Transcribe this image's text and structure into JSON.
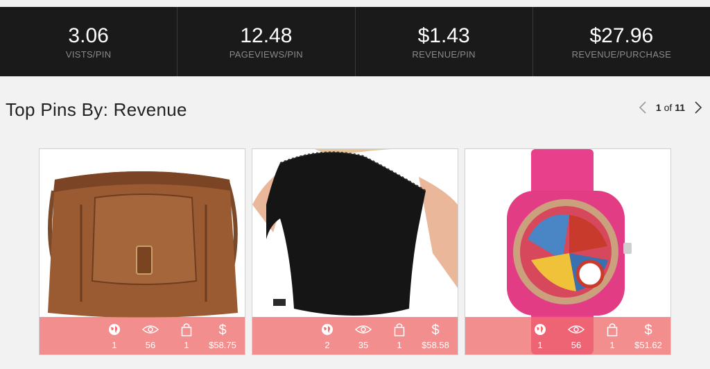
{
  "stats": [
    {
      "value": "3.06",
      "label": "VISTS/PIN"
    },
    {
      "value": "12.48",
      "label": "PAGEVIEWS/PIN"
    },
    {
      "value": "$1.43",
      "label": "REVENUE/PIN"
    },
    {
      "value": "$27.96",
      "label": "REVENUE/PURCHASE"
    }
  ],
  "section": {
    "title": "Top Pins By: Revenue",
    "pager": {
      "current": "1",
      "of": "of",
      "total": "11"
    }
  },
  "colors": {
    "stats_bg": "#1a1a1a",
    "overlay": "#f06e6e",
    "page_bg": "#f2f2f2"
  },
  "pins": [
    {
      "product": "brown leather bag",
      "repins": "1",
      "views": "56",
      "purchases": "1",
      "revenue": "$58.75"
    },
    {
      "product": "black lace top",
      "repins": "2",
      "views": "35",
      "purchases": "1",
      "revenue": "$58.58"
    },
    {
      "product": "pink comic watch",
      "repins": "1",
      "views": "56",
      "purchases": "1",
      "revenue": "$51.62"
    }
  ],
  "icons": [
    "globe-icon",
    "eye-icon",
    "shopping-bag-icon",
    "dollar-icon"
  ]
}
